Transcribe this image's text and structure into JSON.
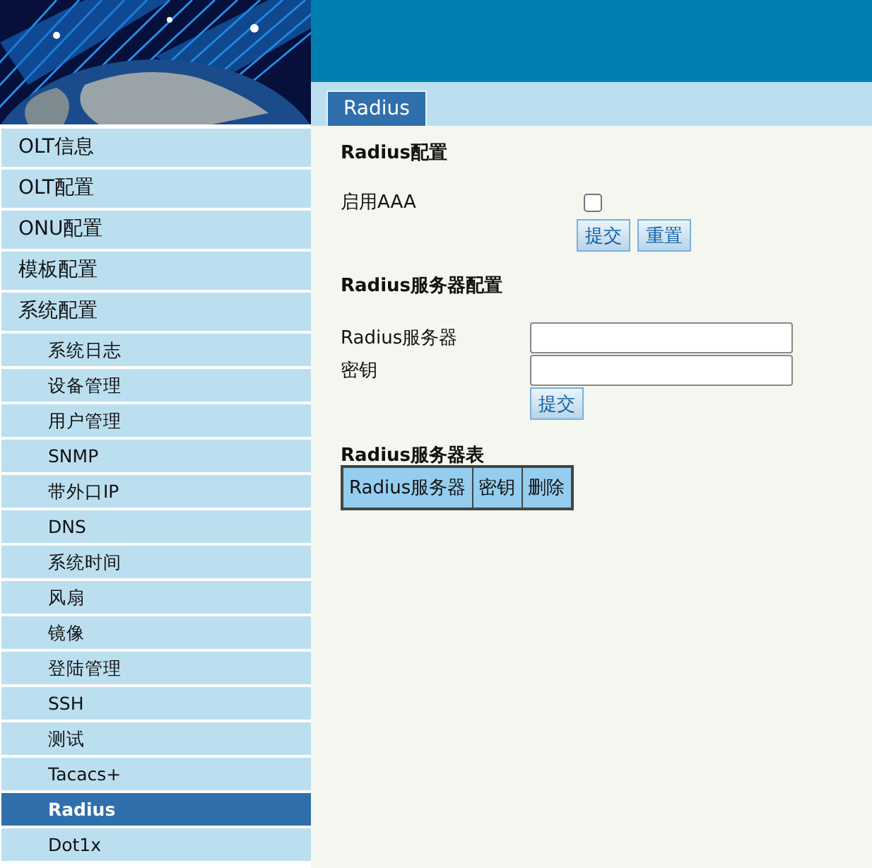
{
  "tabs": [
    {
      "label": "Radius",
      "selected": true
    }
  ],
  "sidebar": {
    "items": [
      {
        "label": "OLT信息",
        "selected": false
      },
      {
        "label": "OLT配置",
        "selected": false
      },
      {
        "label": "ONU配置",
        "selected": false
      },
      {
        "label": "模板配置",
        "selected": false
      },
      {
        "label": "系统配置",
        "selected": false,
        "children": [
          {
            "label": "系统日志",
            "selected": false
          },
          {
            "label": "设备管理",
            "selected": false
          },
          {
            "label": "用户管理",
            "selected": false
          },
          {
            "label": "SNMP",
            "selected": false
          },
          {
            "label": "带外口IP",
            "selected": false
          },
          {
            "label": "DNS",
            "selected": false
          },
          {
            "label": "系统时间",
            "selected": false
          },
          {
            "label": "风扇",
            "selected": false
          },
          {
            "label": "镜像",
            "selected": false
          },
          {
            "label": "登陆管理",
            "selected": false
          },
          {
            "label": "SSH",
            "selected": false
          },
          {
            "label": "测试",
            "selected": false
          },
          {
            "label": "Tacacs+",
            "selected": false
          },
          {
            "label": "Radius",
            "selected": true
          },
          {
            "label": "Dot1x",
            "selected": false
          }
        ]
      }
    ]
  },
  "radius_config": {
    "title": "Radius配置",
    "enable_label": "启用AAA",
    "enable_checked": false,
    "buttons": [
      "提交",
      "重置"
    ]
  },
  "server_config": {
    "title": "Radius服务器配置",
    "fields": [
      {
        "label": "Radius服务器"
      },
      {
        "label": "密钥"
      }
    ],
    "buttons": [
      "提交"
    ]
  },
  "server_table": {
    "title": "Radius服务器表",
    "columns": [
      "Radius服务器",
      "密钥",
      "删除"
    ]
  }
}
